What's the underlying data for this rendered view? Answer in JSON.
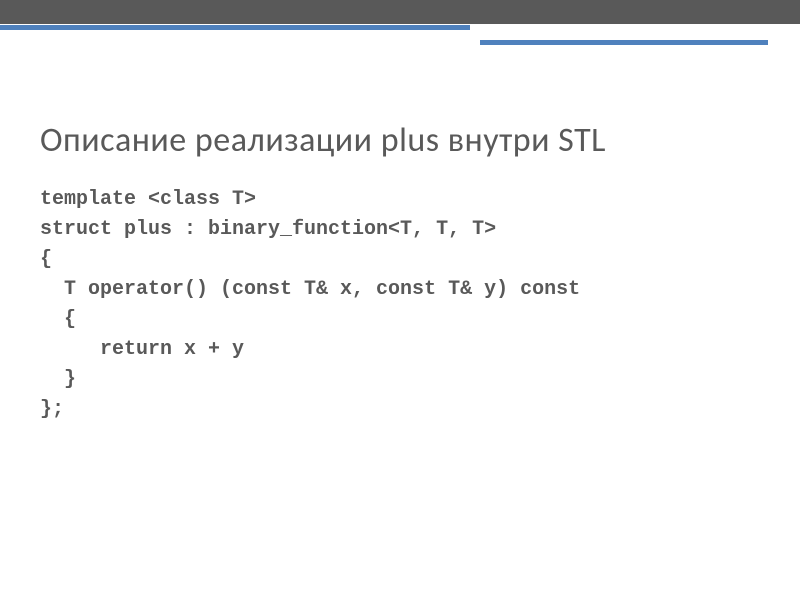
{
  "title": "Описание реализации plus внутри STL",
  "code": {
    "l1": "template <class T>",
    "l2": "struct plus : binary_function<T, T, T>",
    "l3": "{",
    "l4": "  T operator() (const T& x, const T& y) const",
    "l5": "  {",
    "l6": "     return x + y",
    "l7": "  }",
    "l8": "};"
  }
}
